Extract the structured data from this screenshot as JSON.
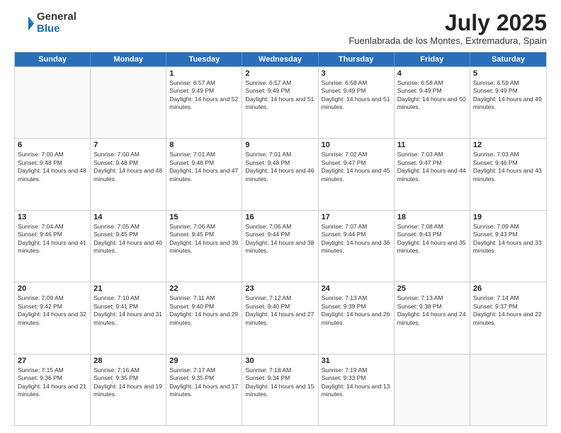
{
  "header": {
    "logo_general": "General",
    "logo_blue": "Blue",
    "title": "July 2025",
    "location": "Fuenlabrada de los Montes, Extremadura, Spain"
  },
  "days_of_week": [
    "Sunday",
    "Monday",
    "Tuesday",
    "Wednesday",
    "Thursday",
    "Friday",
    "Saturday"
  ],
  "weeks": [
    [
      {
        "day": "",
        "sunrise": "",
        "sunset": "",
        "daylight": "",
        "empty": true
      },
      {
        "day": "",
        "sunrise": "",
        "sunset": "",
        "daylight": "",
        "empty": true
      },
      {
        "day": "1",
        "sunrise": "Sunrise: 6:57 AM",
        "sunset": "Sunset: 9:49 PM",
        "daylight": "Daylight: 14 hours and 52 minutes.",
        "empty": false
      },
      {
        "day": "2",
        "sunrise": "Sunrise: 6:57 AM",
        "sunset": "Sunset: 9:49 PM",
        "daylight": "Daylight: 14 hours and 51 minutes.",
        "empty": false
      },
      {
        "day": "3",
        "sunrise": "Sunrise: 6:58 AM",
        "sunset": "Sunset: 9:49 PM",
        "daylight": "Daylight: 14 hours and 51 minutes.",
        "empty": false
      },
      {
        "day": "4",
        "sunrise": "Sunrise: 6:58 AM",
        "sunset": "Sunset: 9:49 PM",
        "daylight": "Daylight: 14 hours and 50 minutes.",
        "empty": false
      },
      {
        "day": "5",
        "sunrise": "Sunrise: 6:59 AM",
        "sunset": "Sunset: 9:49 PM",
        "daylight": "Daylight: 14 hours and 49 minutes.",
        "empty": false
      }
    ],
    [
      {
        "day": "6",
        "sunrise": "Sunrise: 7:00 AM",
        "sunset": "Sunset: 9:48 PM",
        "daylight": "Daylight: 14 hours and 48 minutes.",
        "empty": false
      },
      {
        "day": "7",
        "sunrise": "Sunrise: 7:00 AM",
        "sunset": "Sunset: 9:48 PM",
        "daylight": "Daylight: 14 hours and 48 minutes.",
        "empty": false
      },
      {
        "day": "8",
        "sunrise": "Sunrise: 7:01 AM",
        "sunset": "Sunset: 9:48 PM",
        "daylight": "Daylight: 14 hours and 47 minutes.",
        "empty": false
      },
      {
        "day": "9",
        "sunrise": "Sunrise: 7:01 AM",
        "sunset": "Sunset: 9:48 PM",
        "daylight": "Daylight: 14 hours and 46 minutes.",
        "empty": false
      },
      {
        "day": "10",
        "sunrise": "Sunrise: 7:02 AM",
        "sunset": "Sunset: 9:47 PM",
        "daylight": "Daylight: 14 hours and 45 minutes.",
        "empty": false
      },
      {
        "day": "11",
        "sunrise": "Sunrise: 7:03 AM",
        "sunset": "Sunset: 9:47 PM",
        "daylight": "Daylight: 14 hours and 44 minutes.",
        "empty": false
      },
      {
        "day": "12",
        "sunrise": "Sunrise: 7:03 AM",
        "sunset": "Sunset: 9:46 PM",
        "daylight": "Daylight: 14 hours and 43 minutes.",
        "empty": false
      }
    ],
    [
      {
        "day": "13",
        "sunrise": "Sunrise: 7:04 AM",
        "sunset": "Sunset: 9:46 PM",
        "daylight": "Daylight: 14 hours and 41 minutes.",
        "empty": false
      },
      {
        "day": "14",
        "sunrise": "Sunrise: 7:05 AM",
        "sunset": "Sunset: 9:45 PM",
        "daylight": "Daylight: 14 hours and 40 minutes.",
        "empty": false
      },
      {
        "day": "15",
        "sunrise": "Sunrise: 7:06 AM",
        "sunset": "Sunset: 9:45 PM",
        "daylight": "Daylight: 14 hours and 39 minutes.",
        "empty": false
      },
      {
        "day": "16",
        "sunrise": "Sunrise: 7:06 AM",
        "sunset": "Sunset: 9:44 PM",
        "daylight": "Daylight: 14 hours and 38 minutes.",
        "empty": false
      },
      {
        "day": "17",
        "sunrise": "Sunrise: 7:07 AM",
        "sunset": "Sunset: 9:44 PM",
        "daylight": "Daylight: 14 hours and 36 minutes.",
        "empty": false
      },
      {
        "day": "18",
        "sunrise": "Sunrise: 7:08 AM",
        "sunset": "Sunset: 9:43 PM",
        "daylight": "Daylight: 14 hours and 35 minutes.",
        "empty": false
      },
      {
        "day": "19",
        "sunrise": "Sunrise: 7:09 AM",
        "sunset": "Sunset: 9:43 PM",
        "daylight": "Daylight: 14 hours and 33 minutes.",
        "empty": false
      }
    ],
    [
      {
        "day": "20",
        "sunrise": "Sunrise: 7:09 AM",
        "sunset": "Sunset: 9:42 PM",
        "daylight": "Daylight: 14 hours and 32 minutes.",
        "empty": false
      },
      {
        "day": "21",
        "sunrise": "Sunrise: 7:10 AM",
        "sunset": "Sunset: 9:41 PM",
        "daylight": "Daylight: 14 hours and 31 minutes.",
        "empty": false
      },
      {
        "day": "22",
        "sunrise": "Sunrise: 7:11 AM",
        "sunset": "Sunset: 9:40 PM",
        "daylight": "Daylight: 14 hours and 29 minutes.",
        "empty": false
      },
      {
        "day": "23",
        "sunrise": "Sunrise: 7:12 AM",
        "sunset": "Sunset: 9:40 PM",
        "daylight": "Daylight: 14 hours and 27 minutes.",
        "empty": false
      },
      {
        "day": "24",
        "sunrise": "Sunrise: 7:13 AM",
        "sunset": "Sunset: 9:39 PM",
        "daylight": "Daylight: 14 hours and 26 minutes.",
        "empty": false
      },
      {
        "day": "25",
        "sunrise": "Sunrise: 7:13 AM",
        "sunset": "Sunset: 9:38 PM",
        "daylight": "Daylight: 14 hours and 24 minutes.",
        "empty": false
      },
      {
        "day": "26",
        "sunrise": "Sunrise: 7:14 AM",
        "sunset": "Sunset: 9:37 PM",
        "daylight": "Daylight: 14 hours and 22 minutes.",
        "empty": false
      }
    ],
    [
      {
        "day": "27",
        "sunrise": "Sunrise: 7:15 AM",
        "sunset": "Sunset: 9:36 PM",
        "daylight": "Daylight: 14 hours and 21 minutes.",
        "empty": false
      },
      {
        "day": "28",
        "sunrise": "Sunrise: 7:16 AM",
        "sunset": "Sunset: 9:35 PM",
        "daylight": "Daylight: 14 hours and 19 minutes.",
        "empty": false
      },
      {
        "day": "29",
        "sunrise": "Sunrise: 7:17 AM",
        "sunset": "Sunset: 9:35 PM",
        "daylight": "Daylight: 14 hours and 17 minutes.",
        "empty": false
      },
      {
        "day": "30",
        "sunrise": "Sunrise: 7:18 AM",
        "sunset": "Sunset: 9:34 PM",
        "daylight": "Daylight: 14 hours and 15 minutes.",
        "empty": false
      },
      {
        "day": "31",
        "sunrise": "Sunrise: 7:19 AM",
        "sunset": "Sunset: 9:33 PM",
        "daylight": "Daylight: 14 hours and 13 minutes.",
        "empty": false
      },
      {
        "day": "",
        "sunrise": "",
        "sunset": "",
        "daylight": "",
        "empty": true
      },
      {
        "day": "",
        "sunrise": "",
        "sunset": "",
        "daylight": "",
        "empty": true
      }
    ]
  ]
}
